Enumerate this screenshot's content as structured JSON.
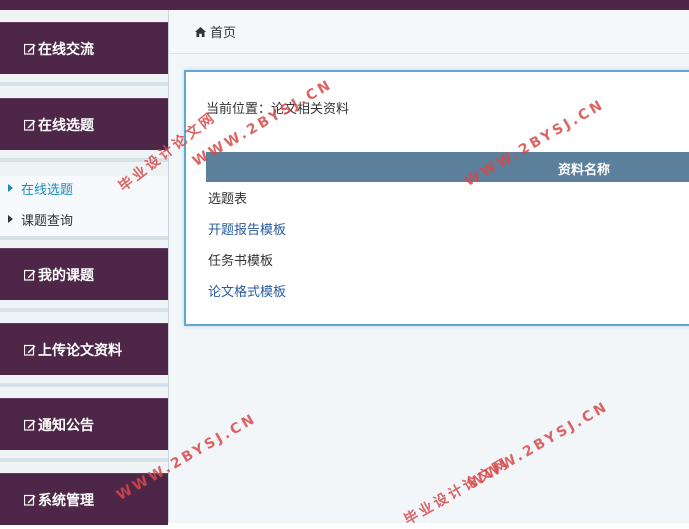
{
  "breadcrumb": {
    "home_label": "首页"
  },
  "sidebar": {
    "sections": [
      {
        "label": "在线交流"
      },
      {
        "label": "在线选题"
      },
      {
        "label": "我的课题"
      },
      {
        "label": "上传论文资料"
      },
      {
        "label": "通知公告"
      },
      {
        "label": "系统管理"
      }
    ],
    "submenu": [
      {
        "label": "在线选题",
        "active": true
      },
      {
        "label": "课题查询",
        "active": false
      }
    ]
  },
  "main": {
    "position_label": "当前位置：论文相关资料",
    "table": {
      "header": "资料名称",
      "rows": [
        {
          "label": "选题表",
          "link": false
        },
        {
          "label": "开题报告模板",
          "link": true
        },
        {
          "label": "任务书模板",
          "link": false
        },
        {
          "label": "论文格式模板",
          "link": true
        }
      ]
    }
  },
  "watermarks": {
    "site": "WWW.2BYSJ.CN",
    "name": "毕业设计论文网"
  },
  "colors": {
    "sidebar_header": "#4e2748",
    "table_header": "#5c7f9c",
    "link": "#2a5a9c",
    "active": "#1f8ac0",
    "panel_border": "#5ea8d1"
  },
  "icons": {
    "sidebar_section": "edit-icon",
    "breadcrumb": "home-icon",
    "submenu": "triangle-right-icon"
  }
}
